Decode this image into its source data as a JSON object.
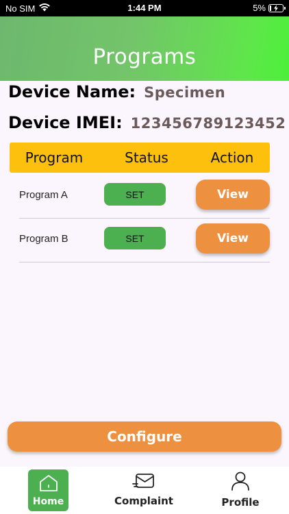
{
  "status_bar": {
    "carrier": "No SIM",
    "time": "1:44 PM",
    "battery": "5%"
  },
  "header": {
    "title": "Programs"
  },
  "device": {
    "name_label": "Device Name:",
    "name_value": "Specimen",
    "imei_label": "Device IMEI:",
    "imei_value": "123456789123452"
  },
  "table": {
    "headers": [
      "Program",
      "Status",
      "Action"
    ],
    "rows": [
      {
        "program": "Program A",
        "status": "SET",
        "action": "View"
      },
      {
        "program": "Program B",
        "status": "SET",
        "action": "View"
      }
    ]
  },
  "configure_label": "Configure",
  "nav": {
    "home": "Home",
    "complaint": "Complaint",
    "profile": "Profile"
  },
  "colors": {
    "header_gradient_start": "#6db86e",
    "header_gradient_end": "#4cf03a",
    "table_header": "#fcc00d",
    "status_badge": "#4caf50",
    "action_button": "#ed9140",
    "home_active": "#4caf50"
  },
  "icons": {
    "wifi": "wifi-icon",
    "battery": "battery-charging-icon",
    "home": "home-icon",
    "complaint": "envelope-icon",
    "profile": "person-icon"
  }
}
